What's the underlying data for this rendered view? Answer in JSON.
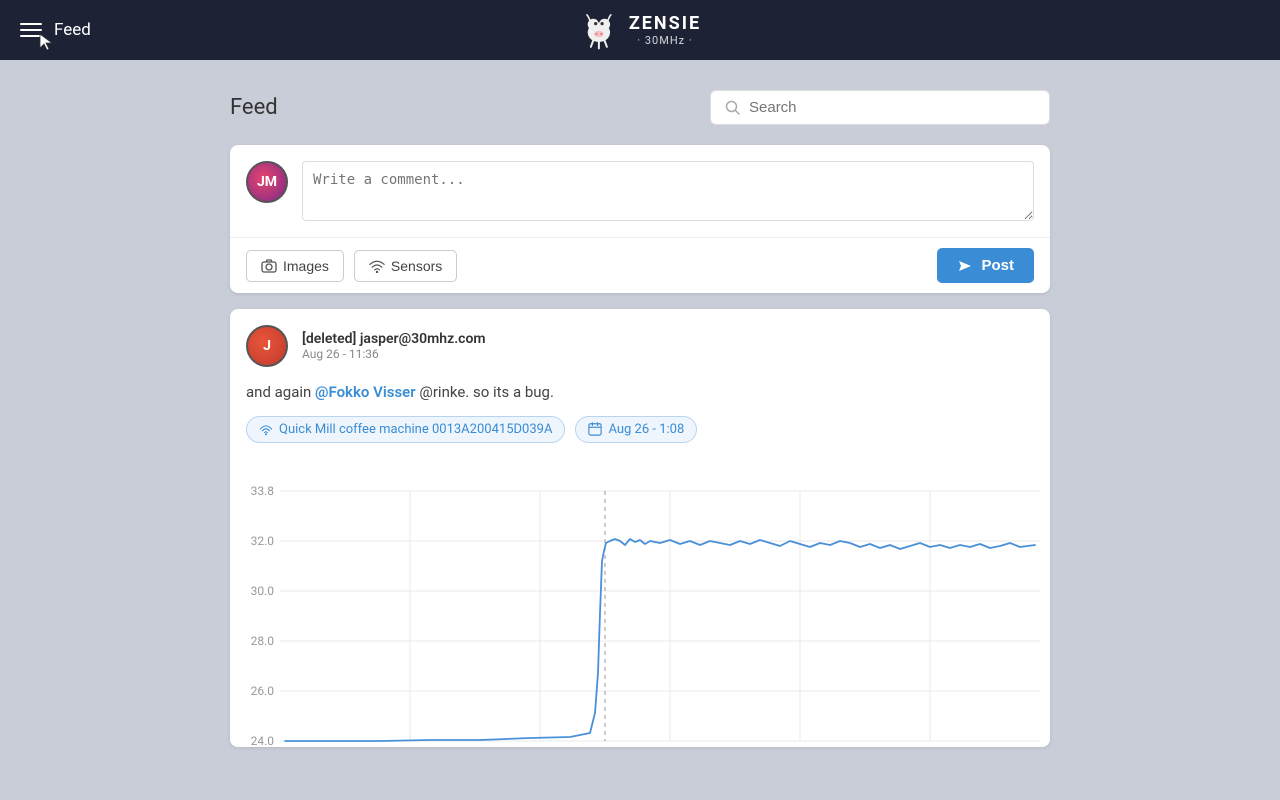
{
  "app": {
    "brand_name": "ZENSIE",
    "brand_sub": "· 30MHz ·",
    "nav_title": "Feed"
  },
  "header": {
    "page_title": "Feed",
    "search_placeholder": "Search"
  },
  "compose": {
    "avatar_initials": "JM",
    "placeholder": "Write a comment...",
    "images_label": "Images",
    "sensors_label": "Sensors",
    "post_label": "Post"
  },
  "post": {
    "avatar_initials": "J",
    "author": "[deleted] jasper@30mhz.com",
    "time": "Aug 26 - 11:36",
    "body_prefix": "and again ",
    "mention": "@Fokko Visser",
    "body_suffix": " @rinke. so its a bug.",
    "sensor_tag_label": "Quick Mill coffee machine 0013A200415D039A",
    "date_tag_label": "Aug 26 - 1:08"
  },
  "chart": {
    "y_labels": [
      "33.8",
      "32.0",
      "30.0",
      "28.0",
      "26.0",
      "24.0"
    ],
    "accent_color": "#4a90d9"
  }
}
